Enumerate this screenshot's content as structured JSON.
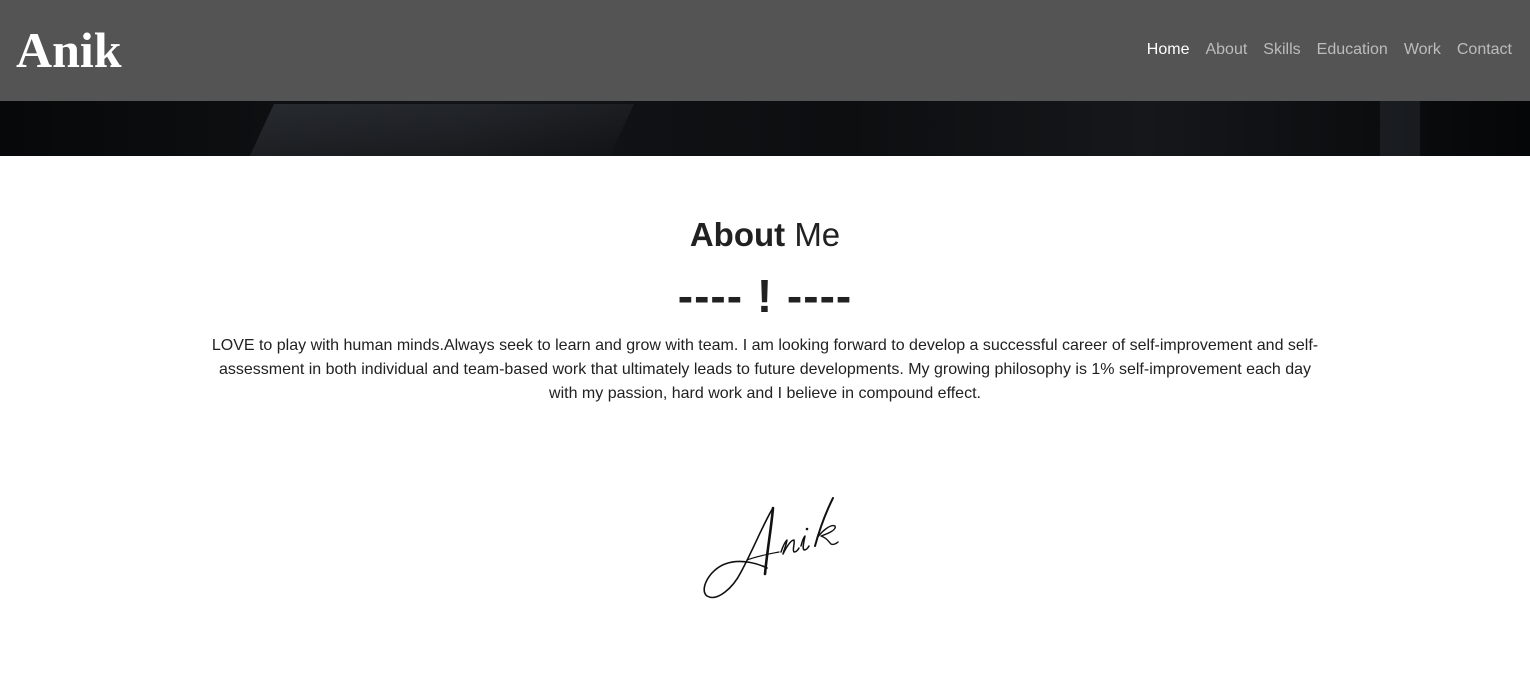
{
  "brand": "Anik",
  "nav": {
    "items": [
      {
        "label": "Home",
        "active": true
      },
      {
        "label": "About",
        "active": false
      },
      {
        "label": "Skills",
        "active": false
      },
      {
        "label": "Education",
        "active": false
      },
      {
        "label": "Work",
        "active": false
      },
      {
        "label": "Contact",
        "active": false
      }
    ]
  },
  "about": {
    "title_bold": "About",
    "title_rest": "Me",
    "divider": "---- ! ----",
    "text": "LOVE to play with human minds.Always seek to learn and grow with team. I am looking forward to develop a successful career of self-improvement and self-assessment in both individual and team-based work that ultimately leads to future developments. My growing philosophy is 1% self-improvement each day with my passion, hard work and I believe in compound effect.",
    "signature": "Anik"
  },
  "colors": {
    "navbar_bg": "#545454",
    "nav_active": "#ffffff",
    "nav_inactive": "#bcbcbc",
    "text": "#212121"
  }
}
